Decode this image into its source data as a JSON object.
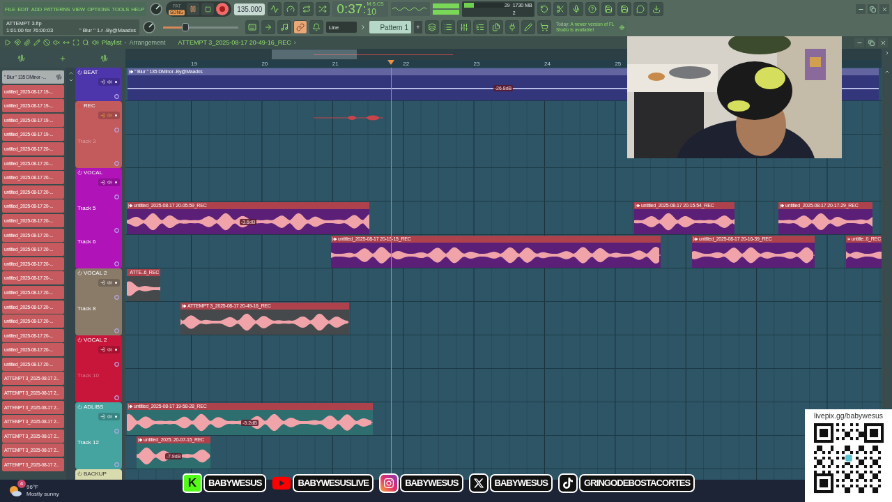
{
  "menu": [
    "FILE",
    "EDIT",
    "ADD",
    "PATTERNS",
    "VIEW",
    "OPTIONS",
    "TOOLS",
    "HELP"
  ],
  "transport": {
    "modes": [
      {
        "label": "PAT",
        "selected": false
      },
      {
        "label": "SONG",
        "selected": true
      }
    ],
    "recording": true,
    "tempo": "135.000"
  },
  "clock": {
    "time": "0:37:",
    "centis": "10",
    "unit": "M:S:CS"
  },
  "cpu": {
    "level": 0.22,
    "value": "29",
    "memory": "1730 MB",
    "voices": "2"
  },
  "hint": {
    "file": "ATTEMPT 3.flp",
    "position": "1:01:00 for 76:00:03",
    "detail": "'' Blur '' 1.r -By@Maadxs"
  },
  "master_pitch": {
    "level": 0.3
  },
  "snap_tools": [
    {
      "selected": false
    },
    {
      "selected": false
    },
    {
      "selected": false
    },
    {
      "selected": true
    },
    {
      "selected": false
    }
  ],
  "snap": {
    "value": "Line"
  },
  "pattern": {
    "name": "Pattern 1",
    "add": "+"
  },
  "notice": {
    "prefix": "Today:",
    "text": "A newer version of FL Studio is available!"
  },
  "playlist": {
    "title": "Playlist",
    "separator": "-",
    "subtitle": "Arrangement",
    "clip": "ATTEMPT 3_2025-08-17 20-49-16_REC",
    "chevron": "›"
  },
  "ruler": [
    "19",
    "20",
    "21",
    "22",
    "23",
    "24",
    "25"
  ],
  "clip_list": [
    {
      "kind": "beat",
      "name": "'' Blur '' 135 DMinor -..."
    },
    {
      "kind": "audio",
      "name": "untitled_2025-08-17 19-..."
    },
    {
      "kind": "audio",
      "name": "untitled_2025-08-17 19-..."
    },
    {
      "kind": "audio",
      "name": "untitled_2025-08-17 19-..."
    },
    {
      "kind": "audio",
      "name": "untitled_2025-08-17 19-..."
    },
    {
      "kind": "audio",
      "name": "untitled_2025-08-17 20-..."
    },
    {
      "kind": "audio",
      "name": "untitled_2025-08-17 20-..."
    },
    {
      "kind": "audio",
      "name": "untitled_2025-08-17 20-..."
    },
    {
      "kind": "audio",
      "name": "untitled_2025-08-17 20-..."
    },
    {
      "kind": "audio",
      "name": "untitled_2025-08-17 20-..."
    },
    {
      "kind": "audio",
      "name": "untitled_2025-08-17 20-..."
    },
    {
      "kind": "audio",
      "name": "untitled_2025-08-17 20-..."
    },
    {
      "kind": "audio",
      "name": "untitled_2025-08-17 20-..."
    },
    {
      "kind": "audio",
      "name": "untitled_2025-08-17 20-..."
    },
    {
      "kind": "audio",
      "name": "untitled_2025-08-17 20-..."
    },
    {
      "kind": "audio",
      "name": "untitled_2025-08-17 20-..."
    },
    {
      "kind": "audio",
      "name": "untitled_2025-08-17 20-..."
    },
    {
      "kind": "audio",
      "name": "untitled_2025-08-17 20-..."
    },
    {
      "kind": "audio",
      "name": "untitled_2025-08-17 20-..."
    },
    {
      "kind": "audio",
      "name": "untitled_2025-08-17 20-..."
    },
    {
      "kind": "audio",
      "name": "untitled_2025-08-17 20-..."
    },
    {
      "kind": "audio",
      "name": "ATTEMPT 3_2025-08-17 2..."
    },
    {
      "kind": "audio",
      "name": "ATTEMPT 3_2025-08-17 2..."
    },
    {
      "kind": "audio",
      "name": "ATTEMPT 3_2025-08-17 2..."
    },
    {
      "kind": "audio",
      "name": "ATTEMPT 3_2025-08-17 2..."
    },
    {
      "kind": "audio",
      "name": "ATTEMPT 3_2025-08-17 2..."
    },
    {
      "kind": "audio",
      "name": "ATTEMPT 3_2025-08-17 2..."
    },
    {
      "kind": "audio",
      "name": "ATTEMPT 3_2025-08-17 2..."
    }
  ],
  "track_groups": [
    {
      "name": "BEAT",
      "color": "#4d36ab",
      "armed": false,
      "clips": [
        {
          "kind": "beat",
          "title": "'' Blur '' 135 DMinor -By@Maadxs",
          "gain": "-26.8dB",
          "color": "#34367c"
        }
      ]
    },
    {
      "name": "REC",
      "color": "#c35a5c",
      "armed": true,
      "clips": [
        {
          "kind": "take",
          "color": "#c8444a"
        }
      ],
      "tracks": [
        {
          "label": "Track 3",
          "dimmed": true
        }
      ]
    },
    {
      "name": "VOCAL",
      "color": "#b013b7",
      "armed": false,
      "tracks": [
        {
          "label": "Track 5",
          "dimmed": false,
          "clips": [
            {
              "kind": "recording",
              "title": "untitled_2025-08-17 20-05-59_REC",
              "gain": "-3.6dB",
              "color": "#5b1f78"
            },
            {
              "kind": "recording",
              "title": "untitled_2025-08-17 20-15-54_REC",
              "color": "#5b1f78"
            },
            {
              "kind": "recording",
              "title": "untitled_2025-08-17 20-17-29_REC",
              "color": "#5b1f78"
            }
          ]
        },
        {
          "label": "Track 6",
          "dimmed": false,
          "clips": [
            {
              "kind": "recording",
              "title": "untitled_2025-08-17 20-15-15_REC",
              "color": "#5b1f78"
            },
            {
              "kind": "recording",
              "title": "untitled_2025-08-17 20-16-39_REC",
              "color": "#5b1f78"
            },
            {
              "kind": "recording",
              "title": "untitle..0_REC",
              "color": "#5b1f78"
            }
          ]
        }
      ]
    },
    {
      "name": "VOCAL 2",
      "color": "#8a7b69",
      "armed": false,
      "clips": [
        {
          "kind": "recording",
          "title": "ATTE..6_REC",
          "color": "#46494c"
        }
      ],
      "tracks": [
        {
          "label": "Track 8",
          "dimmed": false,
          "clips": [
            {
              "kind": "recording",
              "title": "ATTEMPT 3_2025-08-17 20-49-16_REC",
              "color": "#46494c"
            }
          ]
        }
      ]
    },
    {
      "name": "VOCAL 2",
      "color": "#c8163b",
      "armed": false,
      "tracks": [
        {
          "label": "Track 10",
          "dimmed": true
        }
      ]
    },
    {
      "name": "ADLIBS",
      "color": "#45a4a0",
      "armed": false,
      "clips": [
        {
          "kind": "recording",
          "title": "untitled_2025-08-17 19-58-28_REC",
          "gain": "-5.2dB",
          "color": "#2f6e6e"
        }
      ],
      "tracks": [
        {
          "label": "Track 12",
          "dimmed": false,
          "clips": [
            {
              "kind": "recording",
              "title": "untitled_2025..20-07-15_REC",
              "gain": "-7.9dB",
              "color": "#2f6e6e"
            }
          ]
        }
      ]
    },
    {
      "name": "BACKUP",
      "color": "#d8dbad",
      "armed": false
    }
  ],
  "webcam": {
    "kind": "picture"
  },
  "socials": [
    {
      "kind": "kick",
      "logo_text": "K",
      "handle": "BABYWESUS"
    },
    {
      "kind": "youtube",
      "handle": "BABYWESUSLIVE"
    },
    {
      "kind": "instagram",
      "handle": "BABYWESUS"
    },
    {
      "kind": "x",
      "handle": "BABYWESUS"
    },
    {
      "kind": "tiktok",
      "handle": "GRINGODEBOSTACORTES"
    }
  ],
  "donation": {
    "url": "livepix.gg/babywesus"
  },
  "weather": {
    "alerts": "4",
    "temperature": "96°F",
    "condition": "Mostly sunny"
  }
}
